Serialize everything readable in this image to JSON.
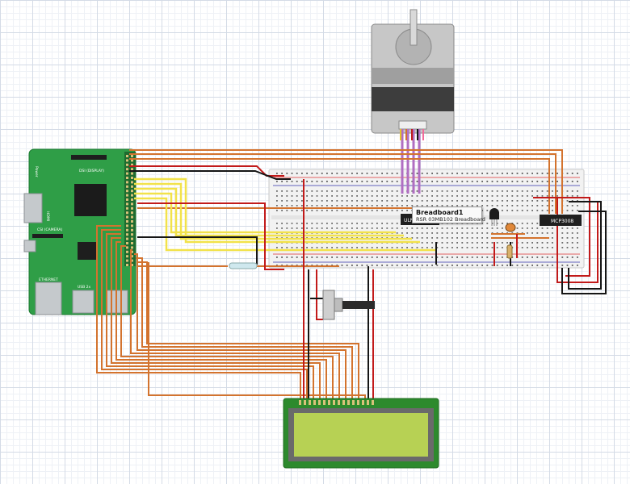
{
  "canvas": {
    "background": "#ffffff",
    "grid_color": "#d4dbe6"
  },
  "raspberry_pi": {
    "board_color": "#2f9e47",
    "labels": {
      "dsi": "DSI (DISPLAY)",
      "csi": "CSI (CAMERA)",
      "hdmi": "HDMI",
      "power": "Power",
      "ethernet": "ETHERNET",
      "usb": "USB 2x"
    }
  },
  "breadboard": {
    "ic_label": "MCP3008",
    "small_ic_label": "ULN"
  },
  "tooltip": {
    "title": "Breadboard1",
    "subtitle": "RSR 03MB102 Breadboard"
  },
  "wire_colors": {
    "orange": "#d3732e",
    "yellow": "#f2e24a",
    "red": "#c21a1a",
    "black": "#151515",
    "purple": "#b06ec2"
  },
  "components": {
    "stepper_motor": "stepper-motor",
    "potentiometer": "potentiometer",
    "lcd": "lcd-16x2",
    "reed_switch": "reed-switch",
    "transistor": "transistor",
    "photoresistor": "photoresistor"
  },
  "lcd": {
    "screen_color": "#b7d154",
    "pcb_color": "#2d8a2d"
  }
}
